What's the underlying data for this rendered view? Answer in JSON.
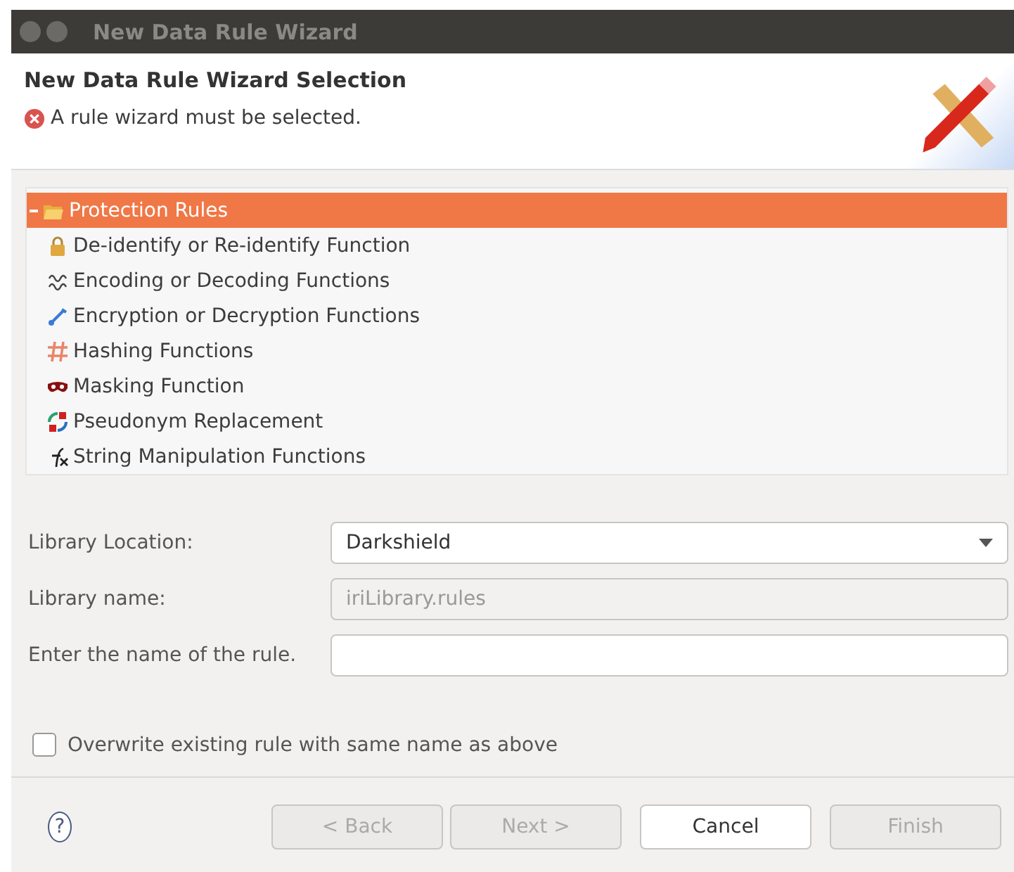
{
  "window": {
    "title": "New Data Rule Wizard"
  },
  "header": {
    "title": "New Data Rule Wizard Selection",
    "message": "A rule wizard must be selected."
  },
  "tree": [
    {
      "label": "Protection Rules",
      "selected": true,
      "expanded": true,
      "children": [
        {
          "label": "De-identify or Re-identify Function",
          "selected": false
        },
        {
          "label": "Encoding or Decoding Functions",
          "selected": false
        },
        {
          "label": "Encryption or Decryption Functions",
          "selected": false
        },
        {
          "label": "Hashing Functions",
          "selected": false
        },
        {
          "label": "Masking Function",
          "selected": false
        },
        {
          "label": "Pseudonym Replacement",
          "selected": false
        },
        {
          "label": "String Manipulation Functions",
          "selected": false
        }
      ]
    }
  ],
  "form": [
    {
      "kind": "dropdown",
      "label": "Library Location:",
      "value": "Darkshield",
      "disabled": false
    },
    {
      "kind": "text",
      "label": "Library name:",
      "value": "iriLibrary.rules",
      "disabled": true
    },
    {
      "kind": "text",
      "label": "Enter the name of the rule.",
      "disabled": false
    }
  ],
  "overwrite": {
    "label": "Overwrite existing rule with same name as above",
    "checked": false
  },
  "help": "?",
  "buttons": [
    {
      "label": "< Back",
      "disabled": true
    },
    {
      "label": "Next >",
      "disabled": true
    },
    {
      "label": "Cancel",
      "disabled": false
    },
    {
      "label": "Finish",
      "disabled": true
    }
  ]
}
